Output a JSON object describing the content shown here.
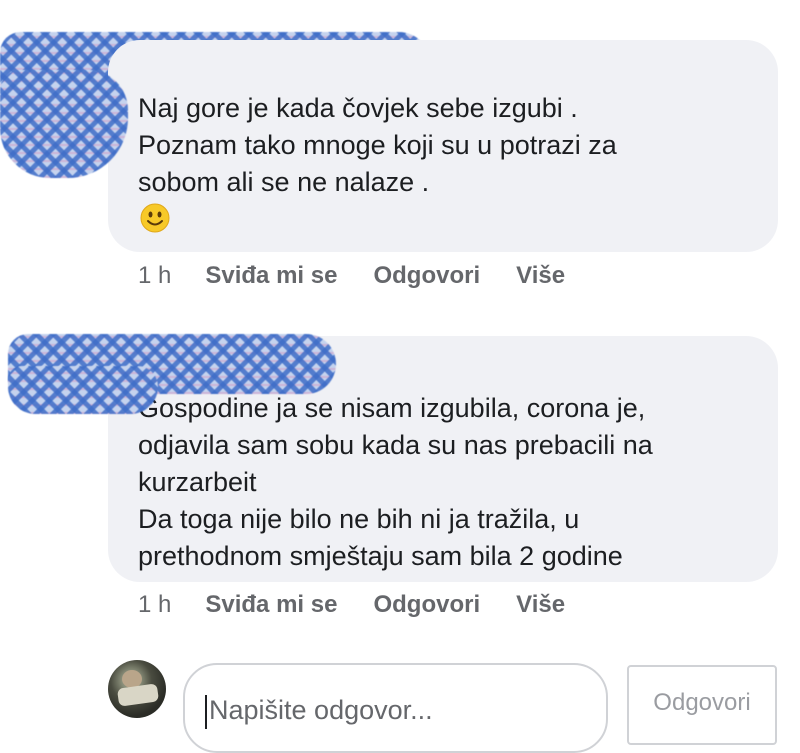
{
  "comments": [
    {
      "text": "Naj gore je kada čovjek sebe izgubi .\nPoznam tako mnoge koji su u potrazi za\nsobom ali se ne nalaze .",
      "emoji": "smiling-face",
      "time": "1 h",
      "actions": [
        "Sviđa mi se",
        "Odgovori",
        "Više"
      ]
    },
    {
      "text": "Gospodine ja se nisam izgubila, corona je,\nodjavila sam sobu kada su nas prebacili na\nkurzarbeit\nDa toga nije bilo ne bih ni ja tražila, u\nprethodnom smještaju sam bila 2 godine",
      "time": "1 h",
      "actions": [
        "Sviđa mi se",
        "Odgovori",
        "Više"
      ]
    }
  ],
  "reply_box": {
    "placeholder": "Napišite odgovor...",
    "button_label": "Odgovori"
  },
  "colors": {
    "bubble": "#f0f1f5",
    "meta_text": "#65676b",
    "body_text": "#1c1e21",
    "redaction_blue": "#3f6ec8"
  }
}
